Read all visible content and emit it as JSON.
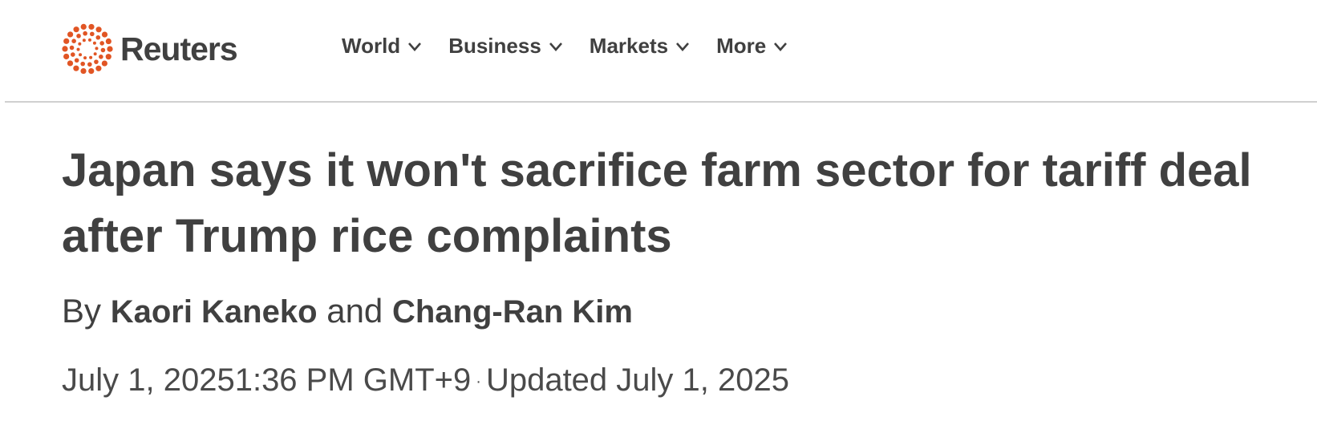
{
  "header": {
    "logo_text": "Reuters",
    "nav": [
      {
        "label": "World"
      },
      {
        "label": "Business"
      },
      {
        "label": "Markets"
      },
      {
        "label": "More"
      }
    ]
  },
  "article": {
    "headline": "Japan says it won't sacrifice farm sector for tariff deal after Trump rice complaints",
    "byline": {
      "prefix": "By",
      "author_1": "Kaori Kaneko",
      "conjunction": "and",
      "author_2": "Chang-Ran Kim"
    },
    "published": "July 1, 2025",
    "published_time": "1:36 PM GMT+9",
    "separator": "·",
    "updated": "Updated July 1, 2025"
  },
  "colors": {
    "brand": "#e15524",
    "text": "#404040",
    "divider": "#d0d0d0"
  },
  "icons": [
    "reuters-logo-icon",
    "chevron-down-icon"
  ]
}
